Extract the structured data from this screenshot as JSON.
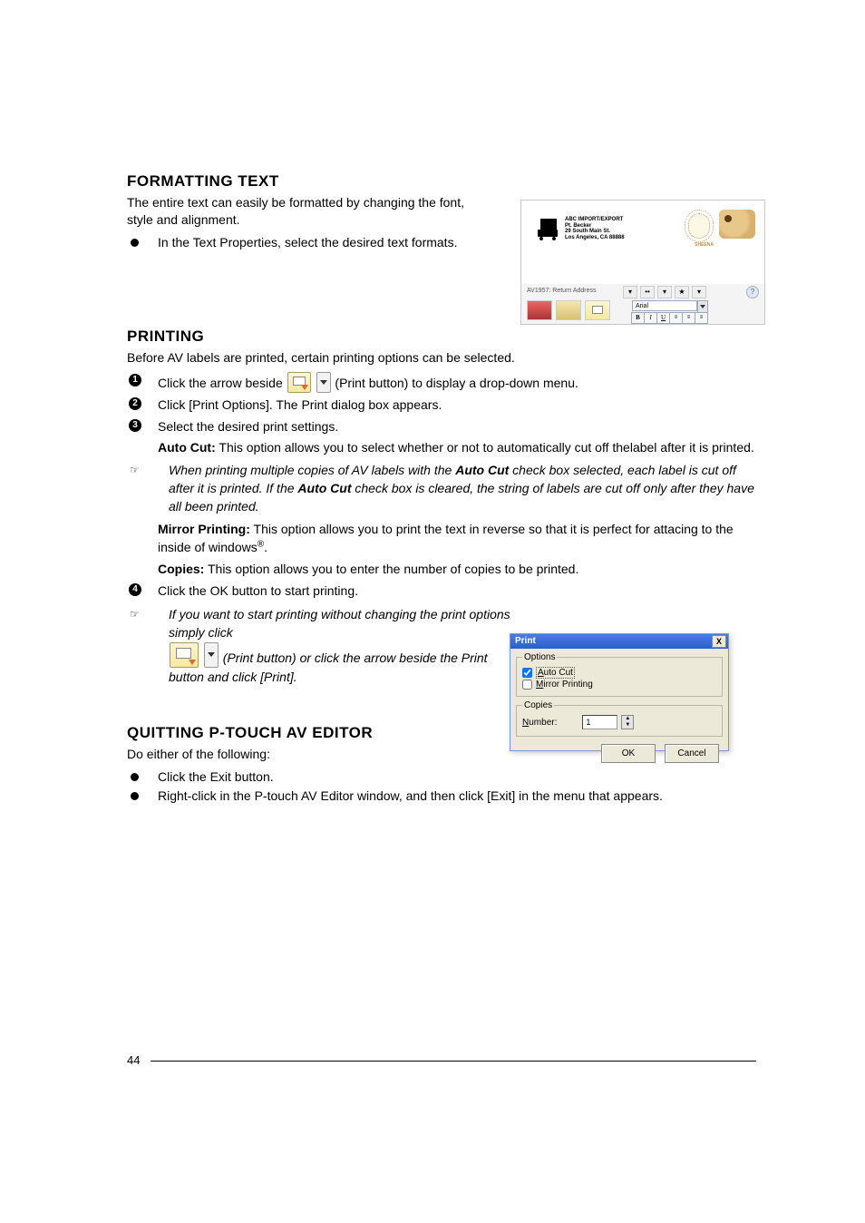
{
  "page_number": "44",
  "formatting": {
    "heading": "FORMATTING TEXT",
    "intro": "The entire text can easily be formatted by changing the font, style and alignment.",
    "bullet1": "In the Text Properties, select the desired text formats."
  },
  "printing": {
    "heading": "PRINTING",
    "intro": "Before AV labels are printed, certain printing options can be selected.",
    "step1_before": "Click the arrow beside ",
    "step1_after": " (Print button) to display a drop-down menu.",
    "step2": "Click [Print Options]. The Print dialog box appears.",
    "step3": "Select the desired print settings.",
    "autocut_label": "Auto Cut:",
    "autocut_text": " This option allows you to select whether or not to automatically cut off thelabel after it is printed.",
    "note1_before": "When printing multiple copies of AV labels with the ",
    "note1_mid": "Auto Cut",
    "note1_after1": " check box selected, each label is cut off after it is printed. If the ",
    "note1_after2": " check box is cleared, the string of labels are cut off only after they have all been printed.",
    "mirror_label": "Mirror Printing:",
    "mirror_text": " This option allows you to print the text in reverse so that it is perfect for attacing to the inside of windows",
    "copies_label": "Copies:",
    "copies_text": " This option allows you to enter the number of copies to be printed.",
    "step4": "Click the OK button to start printing.",
    "note2a": "If you want to start printing without changing the print options simply click",
    "note2b": " (Print button) or click the arrow beside the Print button and click [Print]."
  },
  "quitting": {
    "heading": "QUITTING P-TOUCH AV EDITOR",
    "intro": "Do either of the following:",
    "bullet1": "Click the Exit button.",
    "bullet2": "Right-click in the P-touch AV Editor window, and then click [Exit] in the menu that appears."
  },
  "shot1": {
    "addr": "ABC IMPORT/EXPORT\nPt. Becker\n29 South Main St.\nLos Angeles, CA 88888",
    "stamp": "SHEENA",
    "desc": "AV1957: Return Address",
    "font": "Arial",
    "b": "B",
    "i": "I",
    "u": "U",
    "star": "★",
    "dots": "••",
    "help": "?"
  },
  "shot2": {
    "title": "Print",
    "close": "X",
    "options_legend": "Options",
    "autocut": "Auto Cut",
    "autocut_u": "A",
    "mirror": "Mirror Printing",
    "mirror_u": "M",
    "copies_legend": "Copies",
    "number": "Number:",
    "number_u": "N",
    "number_value": "1",
    "ok": "OK",
    "cancel": "Cancel",
    "up": "▲",
    "down": "▼"
  },
  "marks": {
    "note": "☞",
    "n1": "1",
    "n2": "2",
    "n3": "3",
    "n4": "4",
    "reg": "®",
    "period": "."
  }
}
